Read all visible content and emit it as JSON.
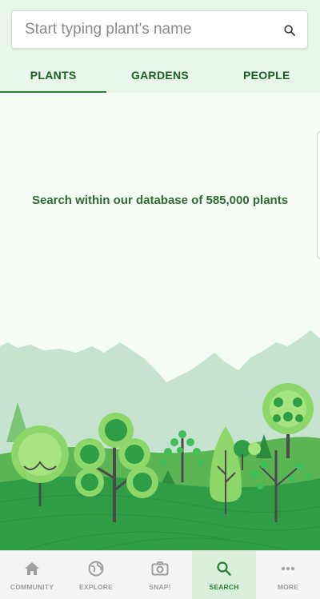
{
  "search": {
    "placeholder": "Start typing plant's name",
    "value": "",
    "icon": "search-icon"
  },
  "tabs": [
    {
      "label": "PLANTS",
      "active": true
    },
    {
      "label": "GARDENS",
      "active": false
    },
    {
      "label": "PEOPLE",
      "active": false
    }
  ],
  "main": {
    "message": "Search within our database of 585,000 plants"
  },
  "bottom_nav": [
    {
      "label": "COMMUNITY",
      "icon": "home-icon",
      "active": false
    },
    {
      "label": "EXPLORE",
      "icon": "globe-icon",
      "active": false
    },
    {
      "label": "SNAP!",
      "icon": "camera-icon",
      "active": false
    },
    {
      "label": "SEARCH",
      "icon": "search-icon",
      "active": true
    },
    {
      "label": "MORE",
      "icon": "more-icon",
      "active": false
    }
  ],
  "colors": {
    "accent": "#2e7d32",
    "header_bg": "#e8f5e9",
    "page_bg": "#f5fcf5",
    "active_nav_bg": "#d8f0dc"
  }
}
